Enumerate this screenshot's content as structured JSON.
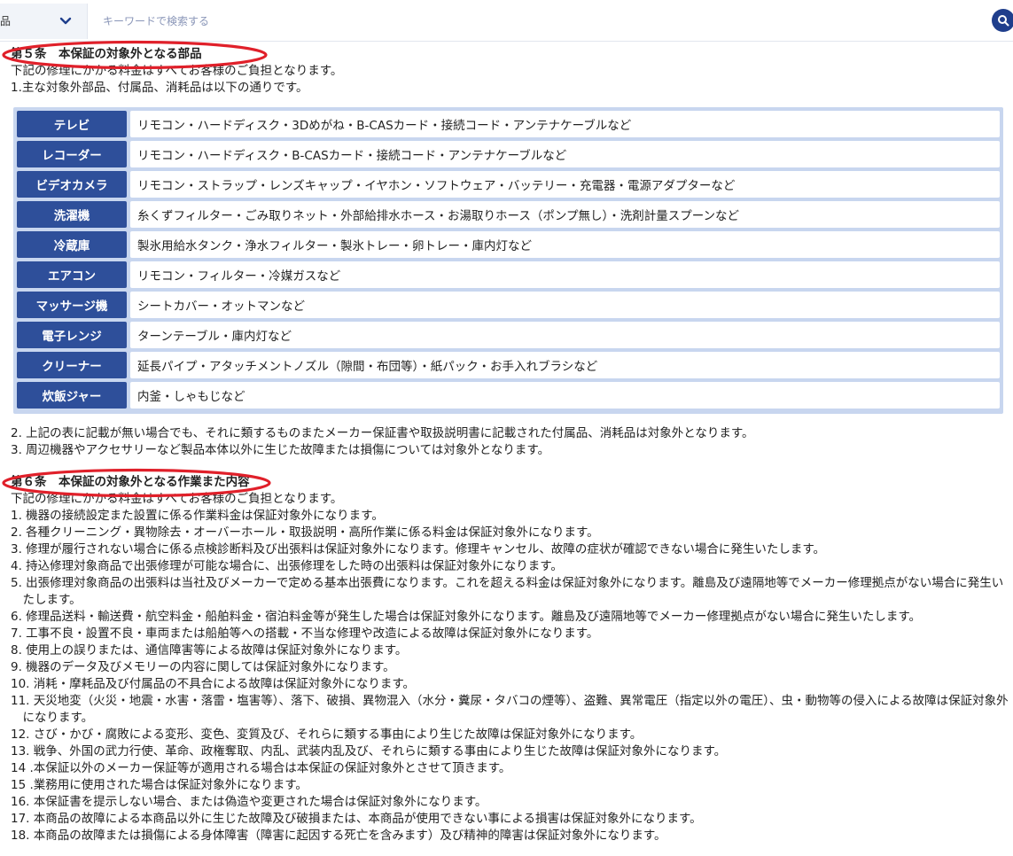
{
  "search": {
    "category_label": "品",
    "placeholder": "キーワードで検索する"
  },
  "colors": {
    "accent": "#2e4f9a",
    "table_bg": "#c8d6ef",
    "highlight_oval": "#e0202a"
  },
  "section5": {
    "title": "第５条　本保証の対象外となる部品",
    "intro": "下記の修理にかかる料金はすべてお客様のご負担となります。",
    "item1": "1.主な対象外部品、付属品、消耗品は以下の通りです。",
    "table": [
      {
        "category": "テレビ",
        "parts": "リモコン・ハードディスク・3Dめがね・B-CASカード・接続コード・アンテナケーブルなど"
      },
      {
        "category": "レコーダー",
        "parts": "リモコン・ハードディスク・B-CASカード・接続コード・アンテナケーブルなど"
      },
      {
        "category": "ビデオカメラ",
        "parts": "リモコン・ストラップ・レンズキャップ・イヤホン・ソフトウェア・バッテリー・充電器・電源アダプターなど"
      },
      {
        "category": "洗濯機",
        "parts": "糸くずフィルター・ごみ取りネット・外部給排水ホース・お湯取りホース（ポンプ無し）・洗剤計量スプーンなど"
      },
      {
        "category": "冷蔵庫",
        "parts": "製氷用給水タンク・浄水フィルター・製氷トレー・卵トレー・庫内灯など"
      },
      {
        "category": "エアコン",
        "parts": "リモコン・フィルター・冷媒ガスなど"
      },
      {
        "category": "マッサージ機",
        "parts": "シートカバー・オットマンなど"
      },
      {
        "category": "電子レンジ",
        "parts": "ターンテーブル・庫内灯など"
      },
      {
        "category": "クリーナー",
        "parts": "延長パイプ・アタッチメントノズル（隙間・布団等）・紙パック・お手入れブラシなど"
      },
      {
        "category": "炊飯ジャー",
        "parts": "内釜・しゃもじなど"
      }
    ],
    "item2": "2. 上記の表に記載が無い場合でも、それに類するものまたメーカー保証書や取扱説明書に記載された付属品、消耗品は対象外となります。",
    "item3": "3. 周辺機器やアクセサリーなど製品本体以外に生じた故障または損傷については対象外となります。"
  },
  "section6": {
    "title": "第６条　本保証の対象外となる作業また内容",
    "intro": "下記の修理にかかる料金はすべてお客様のご負担となります。",
    "items": [
      "1. 機器の接続設定また設置に係る作業料金は保証対象外になります。",
      "2. 各種クリーニング・異物除去・オーバーホール・取扱説明・高所作業に係る料金は保証対象外になります。",
      "3. 修理が履行されない場合に係る点検診断料及び出張料は保証対象外になります。修理キャンセル、故障の症状が確認できない場合に発生いたします。",
      "4. 持込修理対象商品で出張修理が可能な場合に、出張修理をした時の出張料は保証対象外になります。",
      "5. 出張修理対象商品の出張料は当社及びメーカーで定める基本出張費になります。これを超える料金は保証対象外になります。離島及び遠隔地等でメーカー修理拠点がない場合に発生いたします。",
      "6. 修理品送料・輸送費・航空料金・船舶料金・宿泊料金等が発生した場合は保証対象外になります。離島及び遠隔地等でメーカー修理拠点がない場合に発生いたします。",
      "7. 工事不良・設置不良・車両または船舶等への搭載・不当な修理や改造による故障は保証対象外になります。",
      "8. 使用上の誤りまたは、通信障害等による故障は保証対象外になります。",
      "9. 機器のデータ及びメモリーの内容に関しては保証対象外になります。",
      "10. 消耗・摩耗品及び付属品の不具合による故障は保証対象外になります。",
      "11. 天災地変（火災・地震・水害・落雷・塩害等）、落下、破損、異物混入（水分・糞尿・タバコの煙等）、盗難、異常電圧（指定以外の電圧）、虫・動物等の侵入による故障は保証対象外になります。",
      "12. さび・かび・腐敗による変形、変色、変質及び、それらに類する事由により生じた故障は保証対象外になります。",
      "13. 戦争、外国の武力行使、革命、政権奪取、内乱、武装内乱及び、それらに類する事由により生じた故障は保証対象外になります。",
      "14 .本保証以外のメーカー保証等が適用される場合は本保証の保証対象外とさせて頂きます。",
      "15 .業務用に使用された場合は保証対象外になります。",
      "16. 本保証書を提示しない場合、または偽造や変更された場合は保証対象外になります。",
      "17. 本商品の故障による本商品以外に生じた故障及び破損または、本商品が使用できない事による損害は保証対象外になります。",
      "18. 本商品の故障または損傷による身体障害（障害に起因する死亡を含みます）及び精神的障害は保証対象外になります。"
    ]
  }
}
